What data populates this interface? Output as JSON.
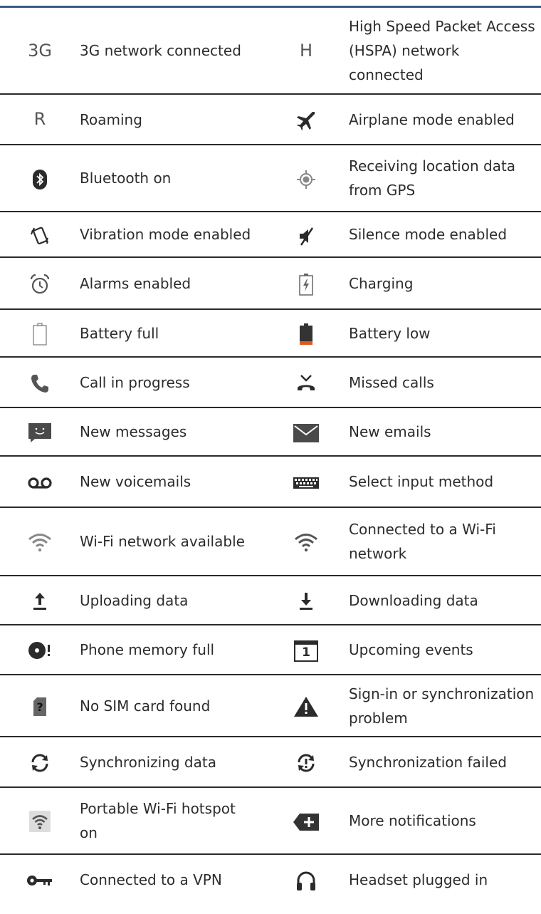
{
  "rows": [
    {
      "left_icon": "3g-text-icon",
      "left_icon_text": "3G",
      "left": "3G network connected",
      "right_icon": "h-text-icon",
      "right_icon_text": "H",
      "right": "High Speed Packet Access (HSPA) network connected"
    },
    {
      "left_icon": "r-text-icon",
      "left_icon_text": "R",
      "left": "Roaming",
      "right_icon": "airplane-icon",
      "right": "Airplane mode enabled"
    },
    {
      "left_icon": "bluetooth-icon",
      "left": "Bluetooth on",
      "right_icon": "gps-icon",
      "right": "Receiving location data from GPS"
    },
    {
      "left_icon": "vibration-icon",
      "left": "Vibration mode enabled",
      "right_icon": "silent-icon",
      "right": "Silence mode enabled"
    },
    {
      "left_icon": "alarm-icon",
      "left": "Alarms enabled",
      "right_icon": "charging-icon",
      "right": "Charging"
    },
    {
      "left_icon": "battery-full-icon",
      "left": "Battery full",
      "right_icon": "battery-low-icon",
      "right": "Battery low"
    },
    {
      "left_icon": "phone-call-icon",
      "left": "Call in progress",
      "right_icon": "missed-call-icon",
      "right": "Missed calls"
    },
    {
      "left_icon": "message-icon",
      "left": "New messages",
      "right_icon": "email-icon",
      "right": "New emails"
    },
    {
      "left_icon": "voicemail-icon",
      "left": "New voicemails",
      "right_icon": "keyboard-icon",
      "right": "Select input method"
    },
    {
      "left_icon": "wifi-available-icon",
      "left": "Wi-Fi network available",
      "right_icon": "wifi-connected-icon",
      "right": "Connected to a Wi-Fi network"
    },
    {
      "left_icon": "upload-icon",
      "left": "Uploading data",
      "right_icon": "download-icon",
      "right": "Downloading data"
    },
    {
      "left_icon": "memory-full-icon",
      "left": "Phone memory full",
      "right_icon": "calendar-icon",
      "right_icon_text": "1",
      "right": "Upcoming events"
    },
    {
      "left_icon": "no-sim-icon",
      "left_icon_text": "?",
      "left": "No SIM card found",
      "right_icon": "warning-icon",
      "right": "Sign-in or synchronization problem"
    },
    {
      "left_icon": "sync-icon",
      "left": "Synchronizing data",
      "right_icon": "sync-failed-icon",
      "right": "Synchronization failed"
    },
    {
      "left_icon": "hotspot-icon",
      "left": "Portable Wi-Fi hotspot on",
      "right_icon": "more-notifications-icon",
      "right": "More notifications"
    },
    {
      "left_icon": "vpn-key-icon",
      "left": "Connected to a VPN",
      "right_icon": "headset-icon",
      "right": "Headset plugged in"
    }
  ]
}
